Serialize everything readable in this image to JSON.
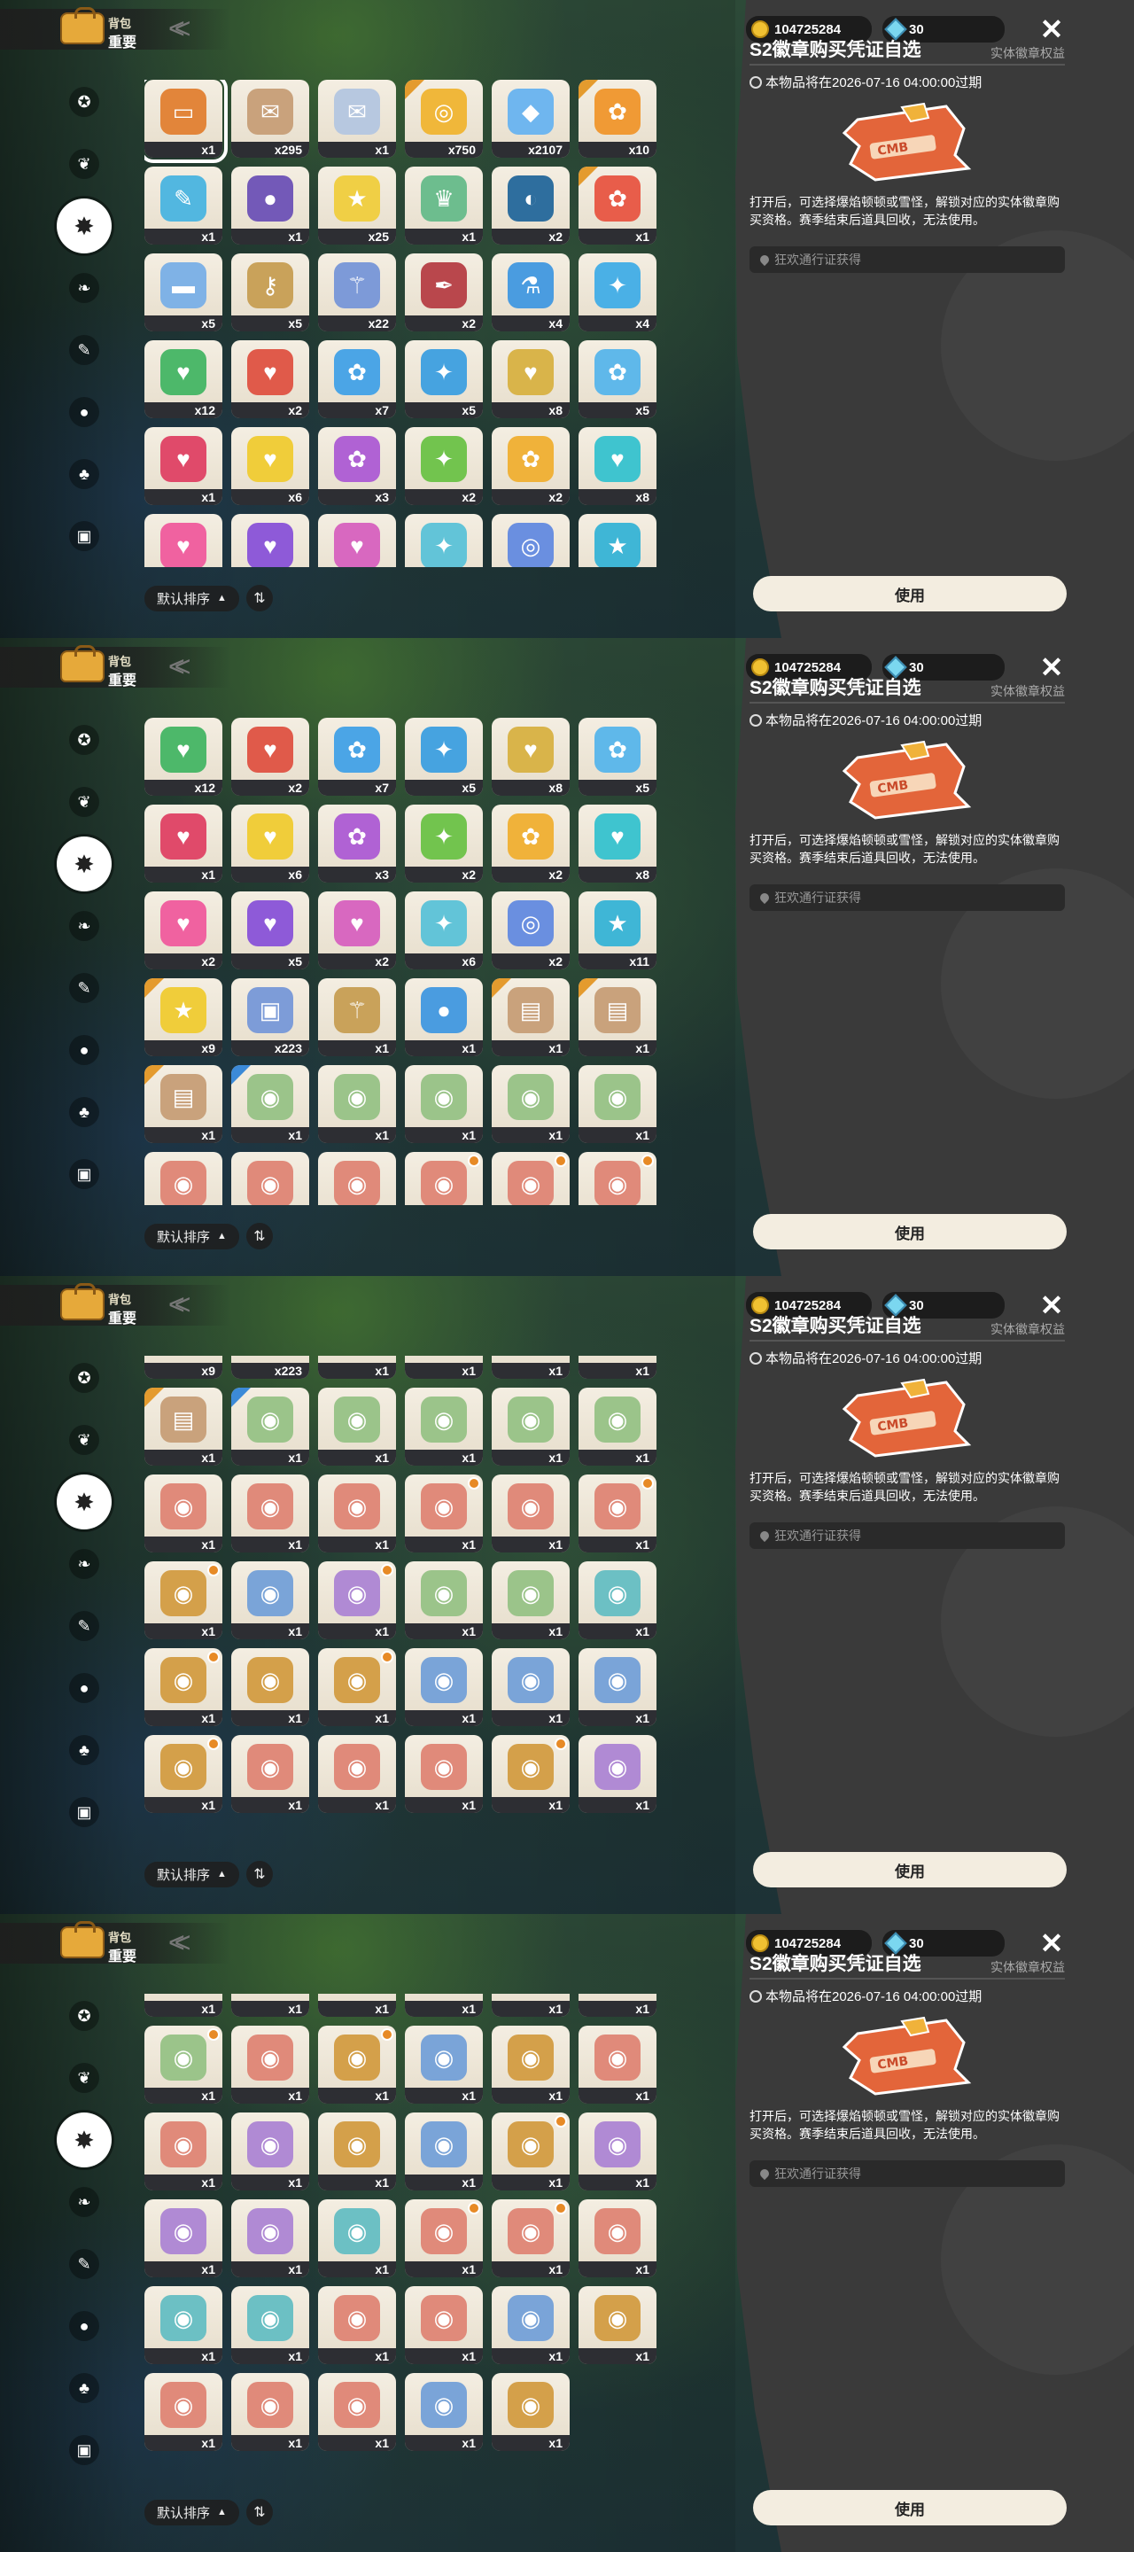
{
  "header": {
    "bag_label": "背包",
    "tab_label": "重要"
  },
  "currency": {
    "coins": "104725284",
    "gems": "30"
  },
  "categories": [
    "star-icon",
    "leaf-icon",
    "gear-icon",
    "leaf2-icon",
    "scroll-icon",
    "ball-icon",
    "acorn-icon",
    "chest-icon"
  ],
  "sort": {
    "label": "默认排序",
    "arrow": "▲",
    "toggle": "⇅"
  },
  "detail": {
    "title": "S2徽章购买凭证自选",
    "tag": "实体徽章权益",
    "expire": "本物品将在2026-07-16 04:00:00过期",
    "description": "打开后，可选择爆焰顿顿或雪怪，解锁对应的实体徽章购买资格。赛季结束后道具回收，无法使用。",
    "source": "狂欢通行证获得",
    "use_button": "使用"
  },
  "colors": {
    "accent": "#e49b2e",
    "panel": "#3a3a3a",
    "button": "#f3ede0"
  },
  "panels": [
    {
      "items": [
        {
          "c": "x1",
          "color": "#e2853a",
          "icon": "▭",
          "sel": true
        },
        {
          "c": "x295",
          "color": "#c9a27c",
          "icon": "✉"
        },
        {
          "c": "x1",
          "color": "#b7c8e0",
          "icon": "✉"
        },
        {
          "c": "x750",
          "color": "#f0b73a",
          "icon": "◎",
          "corner": "gold"
        },
        {
          "c": "x2107",
          "color": "#6fb6ef",
          "icon": "◆"
        },
        {
          "c": "x10",
          "color": "#f09a35",
          "icon": "✿",
          "corner": "gold"
        },
        {
          "c": "x1",
          "color": "#52b7e0",
          "icon": "✎"
        },
        {
          "c": "x1",
          "color": "#7359b8",
          "icon": "●"
        },
        {
          "c": "x25",
          "color": "#f0cf45",
          "icon": "★"
        },
        {
          "c": "x1",
          "color": "#6dbd8e",
          "icon": "♛"
        },
        {
          "c": "x2",
          "color": "#2e6e9e",
          "icon": "◐"
        },
        {
          "c": "x1",
          "color": "#e85d4a",
          "icon": "✿",
          "corner": "gold"
        },
        {
          "c": "x5",
          "color": "#7fb2e6",
          "icon": "▬"
        },
        {
          "c": "x5",
          "color": "#c9a25a",
          "icon": "⚷"
        },
        {
          "c": "x22",
          "color": "#7d9ad8",
          "icon": "⚚"
        },
        {
          "c": "x2",
          "color": "#b9474c",
          "icon": "✒"
        },
        {
          "c": "x4",
          "color": "#4a9ce0",
          "icon": "⚗"
        },
        {
          "c": "x4",
          "color": "#4ab0e6",
          "icon": "✦"
        },
        {
          "c": "x12",
          "color": "#4db86a",
          "icon": "♥"
        },
        {
          "c": "x2",
          "color": "#e05a4a",
          "icon": "♥"
        },
        {
          "c": "x7",
          "color": "#4ba5e6",
          "icon": "✿"
        },
        {
          "c": "x5",
          "color": "#46a3e0",
          "icon": "✦"
        },
        {
          "c": "x8",
          "color": "#d9b44a",
          "icon": "♥"
        },
        {
          "c": "x5",
          "color": "#5fb8ea",
          "icon": "✿"
        },
        {
          "c": "x1",
          "color": "#e04a6a",
          "icon": "♥"
        },
        {
          "c": "x6",
          "color": "#f0cd3a",
          "icon": "♥"
        },
        {
          "c": "x3",
          "color": "#b062d4",
          "icon": "✿"
        },
        {
          "c": "x2",
          "color": "#72c44e",
          "icon": "✦"
        },
        {
          "c": "x2",
          "color": "#f0b23a",
          "icon": "✿"
        },
        {
          "c": "x8",
          "color": "#3fc4cf",
          "icon": "♥"
        },
        {
          "c": "",
          "color": "#f062a0",
          "icon": "♥"
        },
        {
          "c": "",
          "color": "#8e5ad8",
          "icon": "♥"
        },
        {
          "c": "",
          "color": "#d868c0",
          "icon": "♥"
        },
        {
          "c": "",
          "color": "#62c4d8",
          "icon": "✦"
        },
        {
          "c": "",
          "color": "#6a8fe0",
          "icon": "◎"
        },
        {
          "c": "",
          "color": "#3fb6d6",
          "icon": "★"
        }
      ]
    },
    {
      "items": [
        {
          "c": "x12",
          "color": "#4db86a",
          "icon": "♥"
        },
        {
          "c": "x2",
          "color": "#e05a4a",
          "icon": "♥"
        },
        {
          "c": "x7",
          "color": "#4ba5e6",
          "icon": "✿"
        },
        {
          "c": "x5",
          "color": "#46a3e0",
          "icon": "✦"
        },
        {
          "c": "x8",
          "color": "#d9b44a",
          "icon": "♥"
        },
        {
          "c": "x5",
          "color": "#5fb8ea",
          "icon": "✿"
        },
        {
          "c": "x1",
          "color": "#e04a6a",
          "icon": "♥"
        },
        {
          "c": "x6",
          "color": "#f0cd3a",
          "icon": "♥"
        },
        {
          "c": "x3",
          "color": "#b062d4",
          "icon": "✿"
        },
        {
          "c": "x2",
          "color": "#72c44e",
          "icon": "✦"
        },
        {
          "c": "x2",
          "color": "#f0b23a",
          "icon": "✿"
        },
        {
          "c": "x8",
          "color": "#3fc4cf",
          "icon": "♥"
        },
        {
          "c": "x2",
          "color": "#f062a0",
          "icon": "♥"
        },
        {
          "c": "x5",
          "color": "#8e5ad8",
          "icon": "♥"
        },
        {
          "c": "x2",
          "color": "#d868c0",
          "icon": "♥"
        },
        {
          "c": "x6",
          "color": "#62c4d8",
          "icon": "✦"
        },
        {
          "c": "x2",
          "color": "#6a8fe0",
          "icon": "◎"
        },
        {
          "c": "x11",
          "color": "#3fb6d6",
          "icon": "★"
        },
        {
          "c": "x9",
          "color": "#f0cd3a",
          "icon": "★",
          "corner": "gold"
        },
        {
          "c": "x223",
          "color": "#7d9cd8",
          "icon": "▣"
        },
        {
          "c": "x1",
          "color": "#c9a25a",
          "icon": "⚚"
        },
        {
          "c": "x1",
          "color": "#4a9ce0",
          "icon": "●"
        },
        {
          "c": "x1",
          "color": "#c9a27c",
          "icon": "▤",
          "corner": "gold"
        },
        {
          "c": "x1",
          "color": "#c9a27c",
          "icon": "▤",
          "corner": "gold"
        },
        {
          "c": "x1",
          "color": "#c9a27c",
          "icon": "▤",
          "corner": "gold"
        },
        {
          "c": "x1",
          "color": "#9bc48a",
          "icon": "◉",
          "corner": "blue"
        },
        {
          "c": "x1",
          "color": "#9bc48a",
          "icon": "◉"
        },
        {
          "c": "x1",
          "color": "#9bc48a",
          "icon": "◉"
        },
        {
          "c": "x1",
          "color": "#9bc48a",
          "icon": "◉"
        },
        {
          "c": "x1",
          "color": "#9bc48a",
          "icon": "◉"
        },
        {
          "c": "",
          "color": "#e08a7a",
          "icon": "◉"
        },
        {
          "c": "",
          "color": "#e08a7a",
          "icon": "◉"
        },
        {
          "c": "",
          "color": "#e08a7a",
          "icon": "◉"
        },
        {
          "c": "",
          "color": "#e08a7a",
          "icon": "◉",
          "badge": true
        },
        {
          "c": "",
          "color": "#e08a7a",
          "icon": "◉",
          "badge": true
        },
        {
          "c": "",
          "color": "#e08a7a",
          "icon": "◉",
          "badge": true
        }
      ]
    },
    {
      "items": [
        {
          "c": "x9",
          "color": "#f0cd3a",
          "icon": "★",
          "corner": "gold"
        },
        {
          "c": "x223",
          "color": "#7d9cd8",
          "icon": "▣"
        },
        {
          "c": "x1",
          "color": "#c9a25a",
          "icon": "⚚"
        },
        {
          "c": "x1",
          "color": "#4a9ce0",
          "icon": "●"
        },
        {
          "c": "x1",
          "color": "#c9a27c",
          "icon": "▤",
          "corner": "gold"
        },
        {
          "c": "x1",
          "color": "#c9a27c",
          "icon": "▤",
          "corner": "gold"
        },
        {
          "c": "x1",
          "color": "#c9a27c",
          "icon": "▤",
          "corner": "gold"
        },
        {
          "c": "x1",
          "color": "#9bc48a",
          "icon": "◉",
          "corner": "blue"
        },
        {
          "c": "x1",
          "color": "#9bc48a",
          "icon": "◉"
        },
        {
          "c": "x1",
          "color": "#9bc48a",
          "icon": "◉"
        },
        {
          "c": "x1",
          "color": "#9bc48a",
          "icon": "◉"
        },
        {
          "c": "x1",
          "color": "#9bc48a",
          "icon": "◉"
        },
        {
          "c": "x1",
          "color": "#e08a7a",
          "icon": "◉"
        },
        {
          "c": "x1",
          "color": "#e08a7a",
          "icon": "◉"
        },
        {
          "c": "x1",
          "color": "#e08a7a",
          "icon": "◉"
        },
        {
          "c": "x1",
          "color": "#e08a7a",
          "icon": "◉",
          "badge": true
        },
        {
          "c": "x1",
          "color": "#e08a7a",
          "icon": "◉"
        },
        {
          "c": "x1",
          "color": "#e08a7a",
          "icon": "◉",
          "badge": true
        },
        {
          "c": "x1",
          "color": "#d4a04a",
          "icon": "◉",
          "badge": true
        },
        {
          "c": "x1",
          "color": "#7aa4d8",
          "icon": "◉"
        },
        {
          "c": "x1",
          "color": "#b08ad4",
          "icon": "◉",
          "badge": true
        },
        {
          "c": "x1",
          "color": "#9bc48a",
          "icon": "◉"
        },
        {
          "c": "x1",
          "color": "#9bc48a",
          "icon": "◉"
        },
        {
          "c": "x1",
          "color": "#6cc0c4",
          "icon": "◉"
        },
        {
          "c": "x1",
          "color": "#d4a04a",
          "icon": "◉",
          "badge": true
        },
        {
          "c": "x1",
          "color": "#d4a04a",
          "icon": "◉"
        },
        {
          "c": "x1",
          "color": "#d4a04a",
          "icon": "◉",
          "badge": true
        },
        {
          "c": "x1",
          "color": "#7aa4d8",
          "icon": "◉"
        },
        {
          "c": "x1",
          "color": "#7aa4d8",
          "icon": "◉"
        },
        {
          "c": "x1",
          "color": "#7aa4d8",
          "icon": "◉"
        },
        {
          "c": "x1",
          "color": "#d4a04a",
          "icon": "◉",
          "badge": true
        },
        {
          "c": "x1",
          "color": "#e08a7a",
          "icon": "◉"
        },
        {
          "c": "x1",
          "color": "#e08a7a",
          "icon": "◉"
        },
        {
          "c": "x1",
          "color": "#e08a7a",
          "icon": "◉"
        },
        {
          "c": "x1",
          "color": "#d4a04a",
          "icon": "◉",
          "badge": true
        },
        {
          "c": "x1",
          "color": "#b08ad4",
          "icon": "◉"
        }
      ]
    },
    {
      "items": [
        {
          "c": "x1",
          "color": "#e08a7a",
          "icon": "◉"
        },
        {
          "c": "x1",
          "color": "#7aa4d8",
          "icon": "◉"
        },
        {
          "c": "x1",
          "color": "#e08a7a",
          "icon": "◉"
        },
        {
          "c": "x1",
          "color": "#e08a7a",
          "icon": "◉"
        },
        {
          "c": "x1",
          "color": "#e08a7a",
          "icon": "◉"
        },
        {
          "c": "x1",
          "color": "#d4a04a",
          "icon": "◉"
        },
        {
          "c": "x1",
          "color": "#9bc48a",
          "icon": "◉",
          "badge": true
        },
        {
          "c": "x1",
          "color": "#e08a7a",
          "icon": "◉"
        },
        {
          "c": "x1",
          "color": "#d4a04a",
          "icon": "◉",
          "badge": true
        },
        {
          "c": "x1",
          "color": "#7aa4d8",
          "icon": "◉"
        },
        {
          "c": "x1",
          "color": "#d4a04a",
          "icon": "◉"
        },
        {
          "c": "x1",
          "color": "#e08a7a",
          "icon": "◉"
        },
        {
          "c": "x1",
          "color": "#e08a7a",
          "icon": "◉"
        },
        {
          "c": "x1",
          "color": "#b08ad4",
          "icon": "◉"
        },
        {
          "c": "x1",
          "color": "#d4a04a",
          "icon": "◉"
        },
        {
          "c": "x1",
          "color": "#7aa4d8",
          "icon": "◉"
        },
        {
          "c": "x1",
          "color": "#d4a04a",
          "icon": "◉",
          "badge": true
        },
        {
          "c": "x1",
          "color": "#b08ad4",
          "icon": "◉"
        },
        {
          "c": "x1",
          "color": "#b08ad4",
          "icon": "◉"
        },
        {
          "c": "x1",
          "color": "#b08ad4",
          "icon": "◉"
        },
        {
          "c": "x1",
          "color": "#6cc0c4",
          "icon": "◉"
        },
        {
          "c": "x1",
          "color": "#e08a7a",
          "icon": "◉",
          "badge": true
        },
        {
          "c": "x1",
          "color": "#e08a7a",
          "icon": "◉",
          "badge": true
        },
        {
          "c": "x1",
          "color": "#e08a7a",
          "icon": "◉"
        },
        {
          "c": "x1",
          "color": "#6cc0c4",
          "icon": "◉"
        },
        {
          "c": "x1",
          "color": "#6cc0c4",
          "icon": "◉"
        },
        {
          "c": "x1",
          "color": "#e08a7a",
          "icon": "◉"
        },
        {
          "c": "x1",
          "color": "#e08a7a",
          "icon": "◉"
        },
        {
          "c": "x1",
          "color": "#7aa4d8",
          "icon": "◉"
        },
        {
          "c": "x1",
          "color": "#d4a04a",
          "icon": "◉"
        },
        {
          "c": "x1",
          "color": "#e08a7a",
          "icon": "◉"
        },
        {
          "c": "x1",
          "color": "#e08a7a",
          "icon": "◉"
        },
        {
          "c": "x1",
          "color": "#e08a7a",
          "icon": "◉"
        },
        {
          "c": "x1",
          "color": "#7aa4d8",
          "icon": "◉"
        },
        {
          "c": "x1",
          "color": "#d4a04a",
          "icon": "◉"
        }
      ]
    }
  ]
}
